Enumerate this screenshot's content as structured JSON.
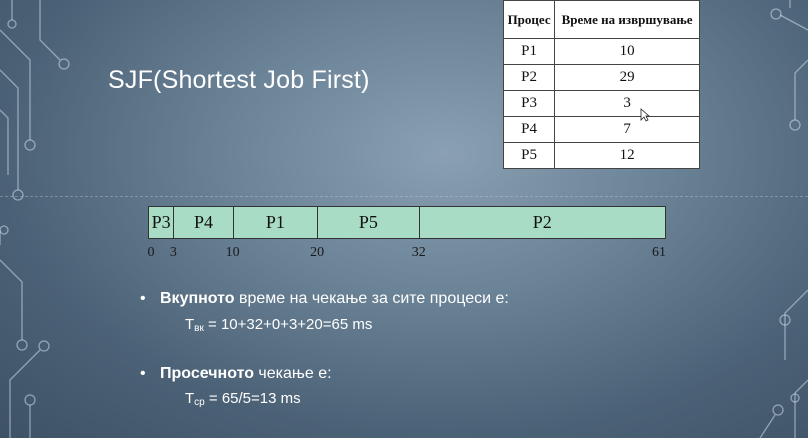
{
  "slide": {
    "title": "SJF(Shortest Job First)"
  },
  "table": {
    "headers": [
      "Процес",
      "Време на извршување"
    ],
    "rows": [
      {
        "process": "P1",
        "time": "10"
      },
      {
        "process": "P2",
        "time": "29"
      },
      {
        "process": "P3",
        "time": "3"
      },
      {
        "process": "P4",
        "time": "7"
      },
      {
        "process": "P5",
        "time": "12"
      }
    ]
  },
  "gantt": {
    "segments": [
      {
        "label": "P3",
        "start": 0,
        "end": 3
      },
      {
        "label": "P4",
        "start": 3,
        "end": 10
      },
      {
        "label": "P1",
        "start": 10,
        "end": 20
      },
      {
        "label": "P5",
        "start": 20,
        "end": 32
      },
      {
        "label": "P2",
        "start": 32,
        "end": 61
      }
    ],
    "ticks": [
      "0",
      "3",
      "10",
      "20",
      "32",
      "61"
    ]
  },
  "bullets": [
    {
      "bold": "Вкупното",
      "rest": " време на чекање за сите процеси е:",
      "formula_symbol": "T",
      "formula_sub": "вк",
      "formula_rest": " = 10+32+0+3+20=65 ms"
    },
    {
      "bold": "Просечното",
      "rest": " чекање е:",
      "formula_symbol": "T",
      "formula_sub": "ср",
      "formula_rest": " = 65/5=13 ms"
    }
  ],
  "colors": {
    "gantt_fill": "#a9dcc4",
    "text": "#ffffff"
  }
}
